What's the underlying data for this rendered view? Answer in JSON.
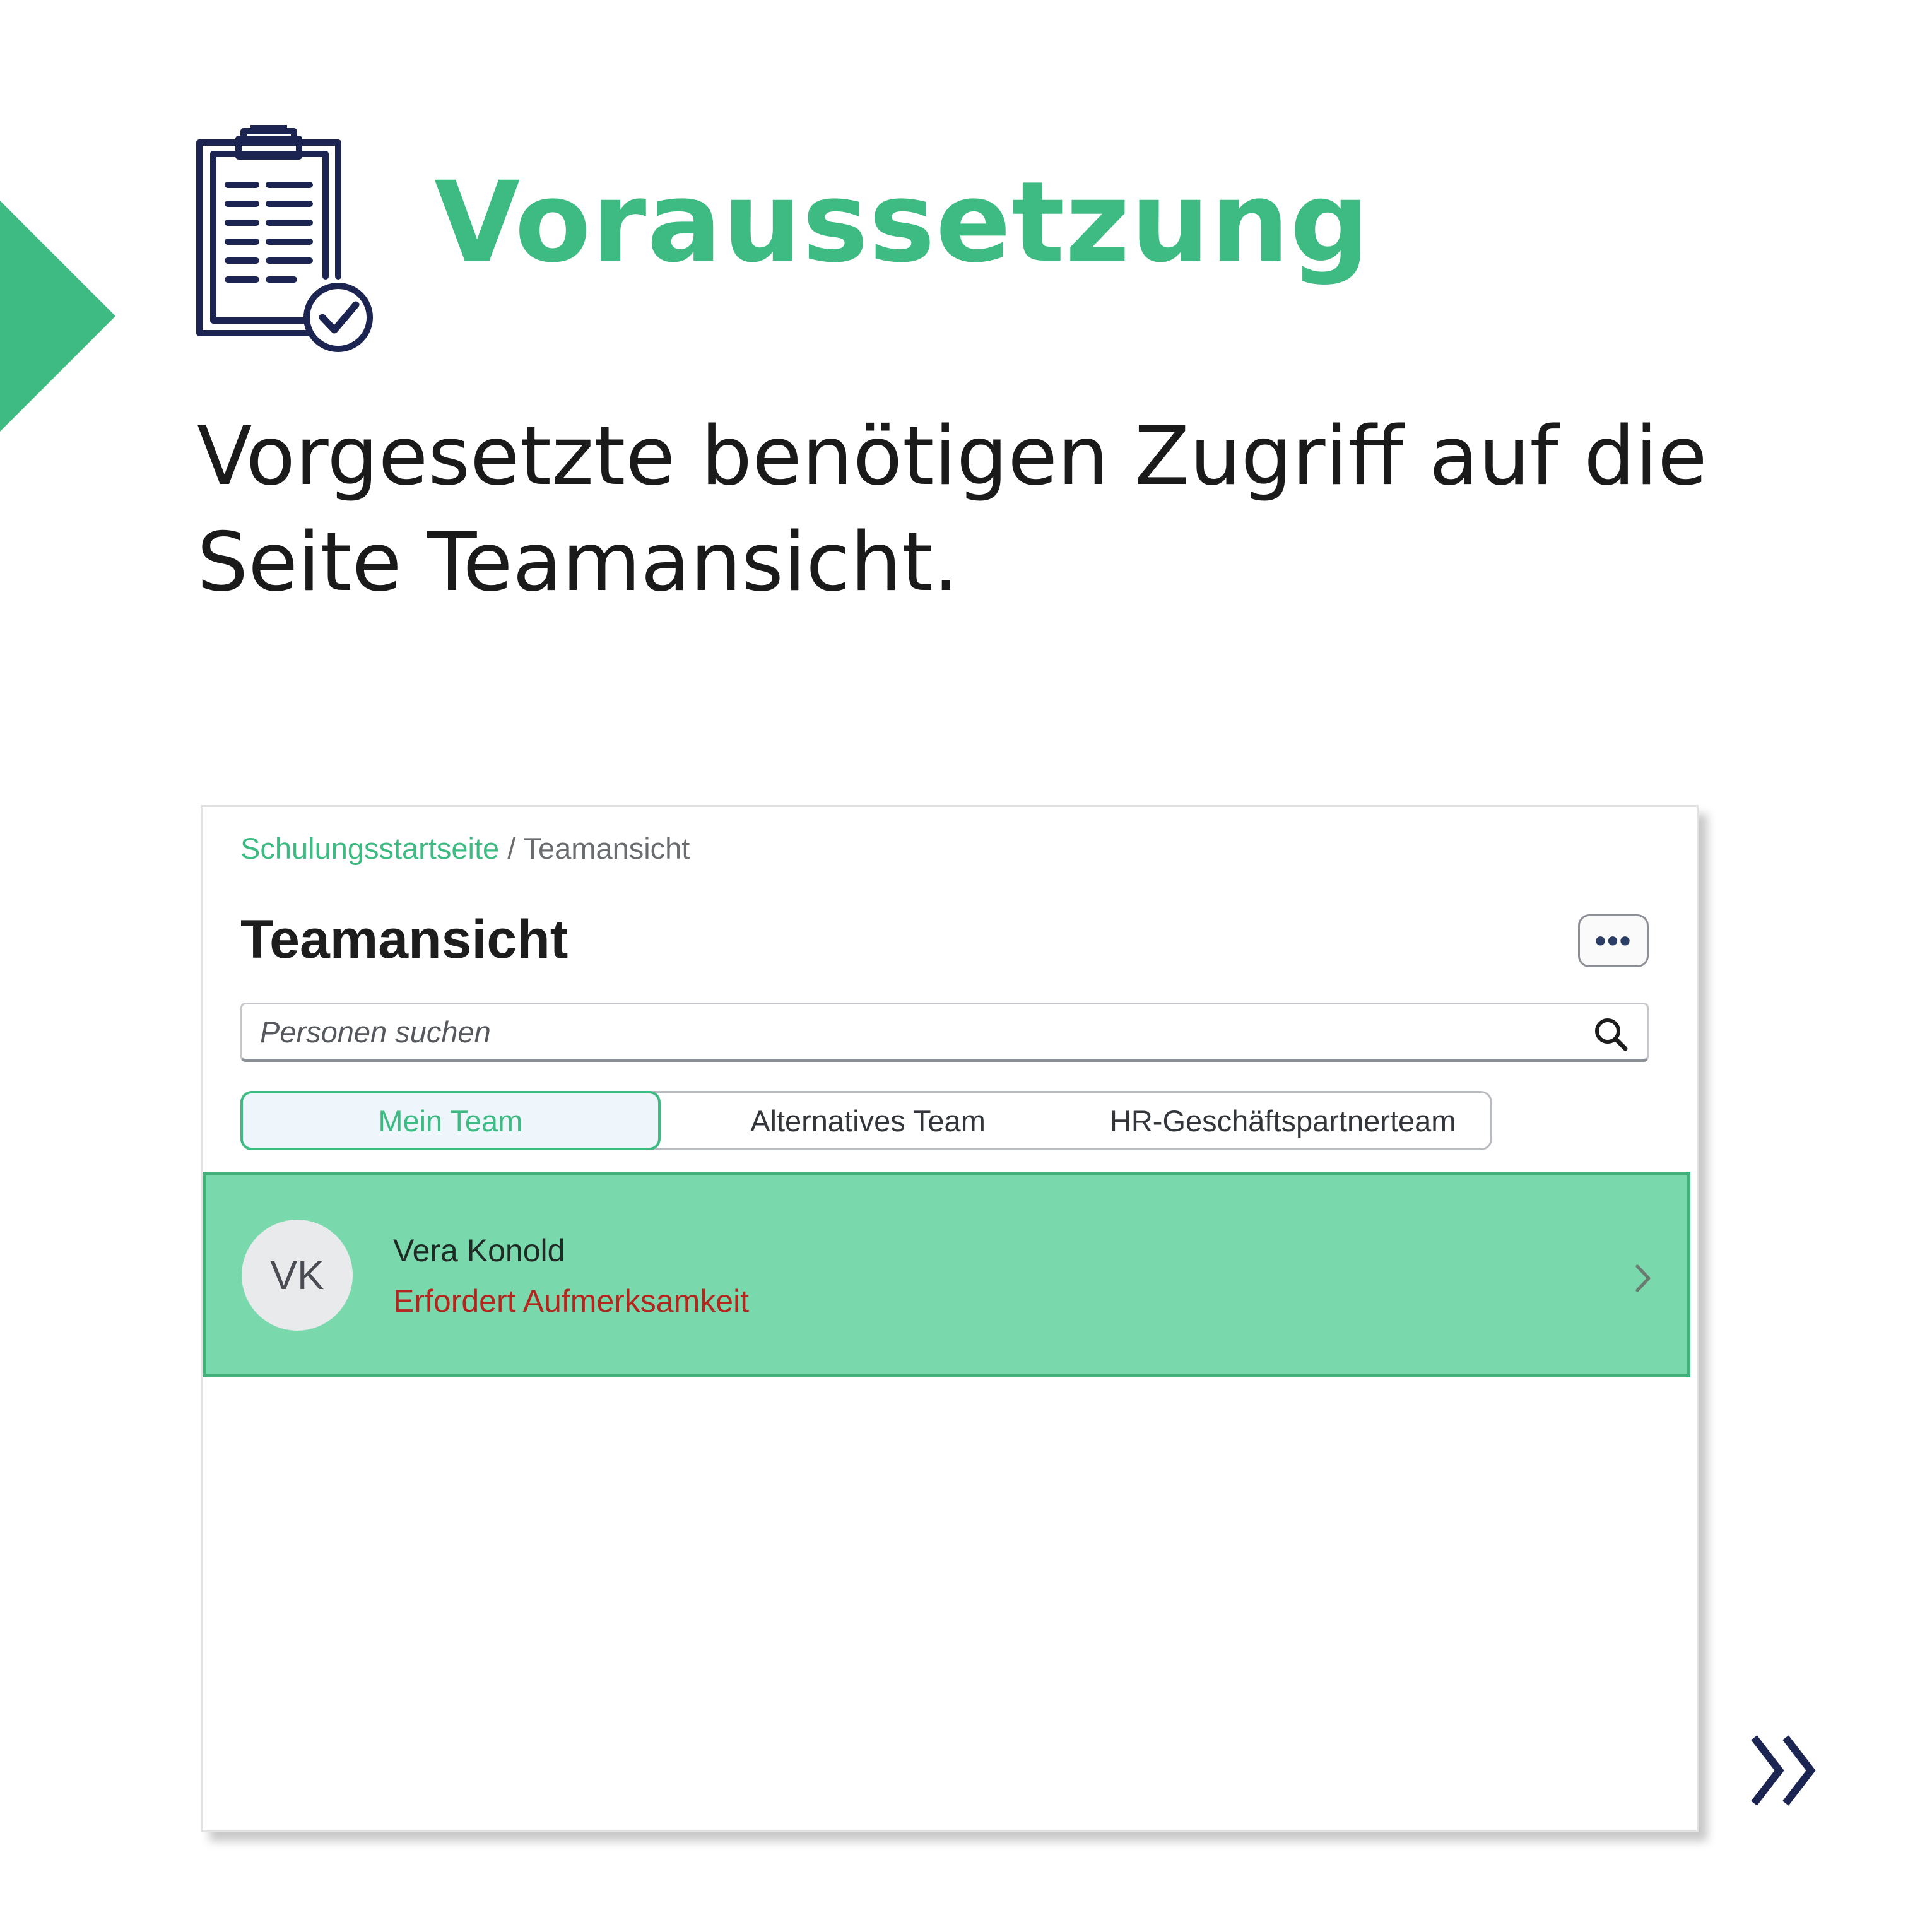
{
  "slide": {
    "heading": "Voraussetzung",
    "text": "Vorgesetzte benötigen Zugriff auf die Seite Teamansicht.",
    "colors": {
      "accent": "#3dbb82",
      "navy": "#1c2551",
      "text": "#1a1a1a"
    },
    "icons": {
      "corner": "play-triangle-icon",
      "heading": "clipboard-check-icon",
      "next": "double-chevron-right-icon"
    }
  },
  "app": {
    "breadcrumb": {
      "link": "Schulungsstartseite",
      "separator": "/",
      "current": "Teamansicht"
    },
    "title": "Teamansicht",
    "more_button": "•••",
    "search": {
      "placeholder": "Personen suchen",
      "value": "",
      "icon": "search-icon"
    },
    "tabs": [
      {
        "label": "Mein Team",
        "active": true
      },
      {
        "label": "Alternatives Team",
        "active": false
      },
      {
        "label": "HR-Geschäftspartnerteam",
        "active": false
      }
    ],
    "team_members": [
      {
        "initials": "VK",
        "name": "Vera Konold",
        "status": "Erfordert Aufmerksamkeit",
        "status_color": "#b3261e",
        "highlight_color": "#79d8ac",
        "icon": "chevron-right-icon"
      }
    ]
  }
}
